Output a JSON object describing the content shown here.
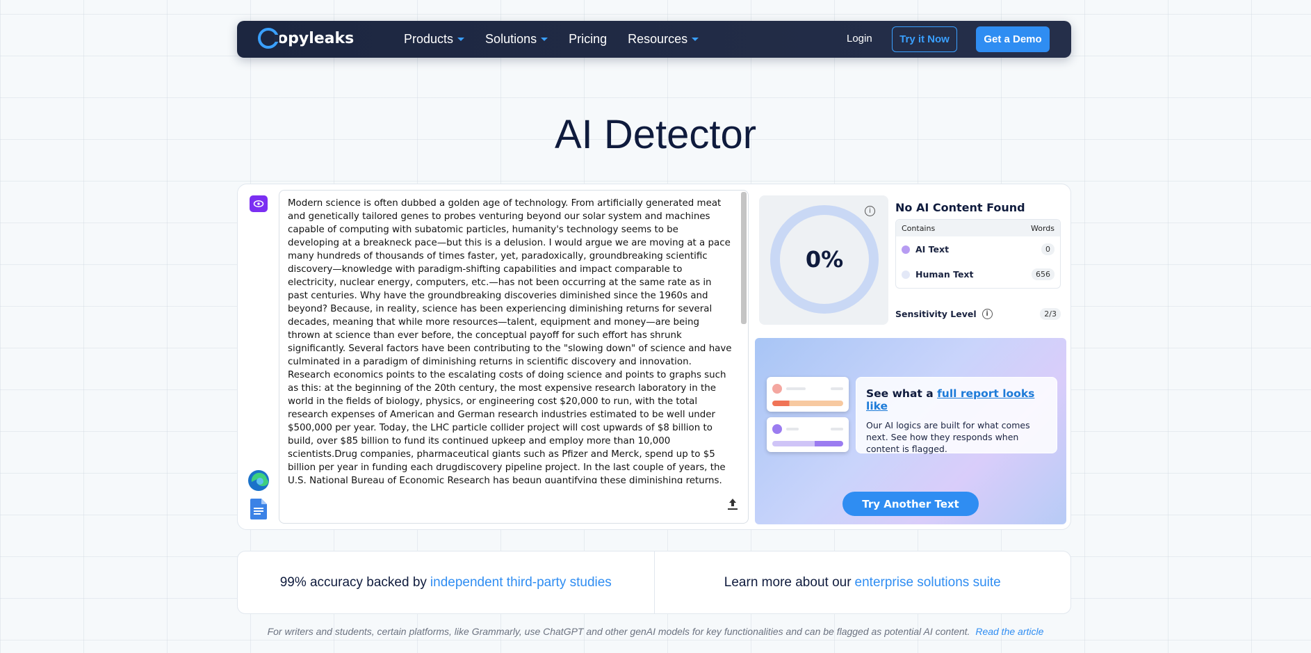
{
  "nav": {
    "logo_text": "opyleaks",
    "links": [
      {
        "label": "Products",
        "dropdown": true
      },
      {
        "label": "Solutions",
        "dropdown": true
      },
      {
        "label": "Pricing",
        "dropdown": false
      },
      {
        "label": "Resources",
        "dropdown": true
      }
    ],
    "login": "Login",
    "try_now": "Try it Now",
    "demo": "Get a Demo"
  },
  "page_title": "AI Detector",
  "editor": {
    "text": "Modern science is often dubbed a golden age of technology. From artificially generated meat and genetically tailored genes to probes venturing beyond our solar system and machines capable of computing with subatomic particles, humanity's technology seems to be developing at a breakneck pace—but this is a delusion. I would argue we are moving at a pace many hundreds of thousands of times faster, yet, paradoxically, groundbreaking scientific discovery—knowledge with paradigm-shifting capabilities and impact comparable to electricity, nuclear energy, computers, etc.—has not been occurring at the same rate as in past centuries. Why have the groundbreaking discoveries diminished since the 1960s and beyond? Because, in reality, science has been experiencing diminishing returns for several decades, meaning that while more resources—talent, equipment and money—are being thrown at science than ever before, the conceptual payoff for such effort has shrunk significantly. Several factors have been contributing to the \"slowing down\" of science and have culminated in a paradigm of diminishing returns in scientific discovery and innovation. Research economics points to the escalating costs of doing science and points to graphs such as this: at the beginning of the 20th century, the most expensive research laboratory in the world in the fields of biology, physics, or engineering cost $20,000 to run, with the total research expenses of American and German research industries estimated to be well under $500,000 per year. Today, the LHC particle collider project will cost upwards of $8 billion to build, over $85 billion to fund its continued upkeep and employ more than 10,000 scientists.Drug companies, pharmaceutical giants such as Pfizer and Merck, spend up to $5 billion per year in funding each drugdiscovery pipeline project. In the last couple of years, the U.S. National Bureau of Economic Research has begun quantifying these diminishing returns. Research paper by Robert Solow at MIT, \"The Economics of Resources: A"
  },
  "result": {
    "score": "0%",
    "title": "No AI Content Found",
    "col_contains": "Contains",
    "col_words": "Words",
    "rows": [
      {
        "label": "AI Text",
        "count": "0",
        "color": "#b79cf2"
      },
      {
        "label": "Human Text",
        "count": "656",
        "color": "#e3e8f7"
      }
    ],
    "sensitivity_label": "Sensitivity Level",
    "sensitivity_value": "2/3"
  },
  "promo": {
    "heading_prefix": "See what a ",
    "heading_link": "full report looks like",
    "body": "Our AI logics are built for what comes next. See how they responds when content is flagged.",
    "button": "Try Another Text"
  },
  "bottom": {
    "left_text": "99% accuracy backed by",
    "left_link": "independent third-party studies",
    "right_text": "Learn more about our",
    "right_link": "enterprise solutions suite"
  },
  "disclaimer": {
    "text": "For writers and students, certain platforms, like Grammarly, use ChatGPT and other genAI models for key functionalities and can be flagged as potential AI content.",
    "link": "Read the article"
  }
}
